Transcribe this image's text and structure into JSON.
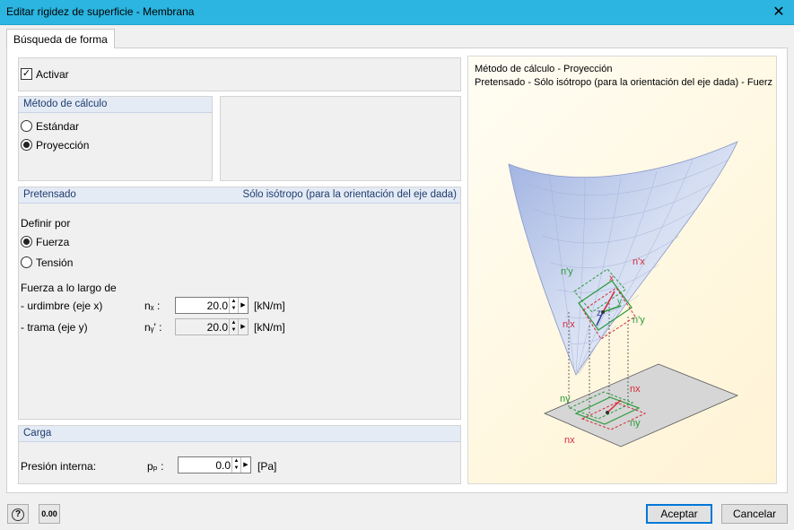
{
  "window": {
    "title": "Editar rigidez de superficie - Membrana",
    "close_glyph": "✕"
  },
  "tabs": [
    {
      "label": "Búsqueda de forma"
    }
  ],
  "activar": {
    "label": "Activar"
  },
  "metodo": {
    "header": "Método de cálculo",
    "options": [
      {
        "label": "Estándar",
        "selected": false
      },
      {
        "label": "Proyección",
        "selected": true
      }
    ]
  },
  "pretensado": {
    "header": "Pretensado",
    "header_right": "Sólo isótropo (para la orientación del eje dada)",
    "definir_label": "Definir por",
    "options": [
      {
        "label": "Fuerza",
        "selected": true
      },
      {
        "label": "Tensión",
        "selected": false
      }
    ],
    "fuerza_label": "Fuerza a lo largo de",
    "rows": [
      {
        "label": "- urdimbre (eje x)",
        "symbol": "nₓ :",
        "value": "20.0",
        "unit": "[kN/m]",
        "enabled": true
      },
      {
        "label": "- trama (eje y)",
        "symbol": "nᵧ' :",
        "value": "20.0",
        "unit": "[kN/m]",
        "enabled": false
      }
    ]
  },
  "carga": {
    "header": "Carga",
    "label": "Presión interna:",
    "symbol": "pₚ :",
    "value": "0.0",
    "unit": "[Pa]"
  },
  "preview": {
    "line1": "Método de cálculo - Proyección",
    "line2": "Pretensado - Sólo isótropo (para la orientación del eje dada) - Fuerz",
    "labels": {
      "ny_prime": "n'y",
      "nx_prime_top": "n'x",
      "nx_prime_bottom": "n'x",
      "ny_prime_right": "n'y",
      "ny_low_left": "ny",
      "nx_low_top": "nx",
      "ny_low_right": "ny",
      "nx_low_bottom": "nx",
      "axis_x": "x",
      "axis_y": "y",
      "axis_z": "z"
    }
  },
  "footer": {
    "accept": "Aceptar",
    "cancel": "Cancelar",
    "units_icon": "0.00"
  },
  "icons": {
    "help": "help-icon",
    "units": "units-icon",
    "close": "close-icon"
  }
}
